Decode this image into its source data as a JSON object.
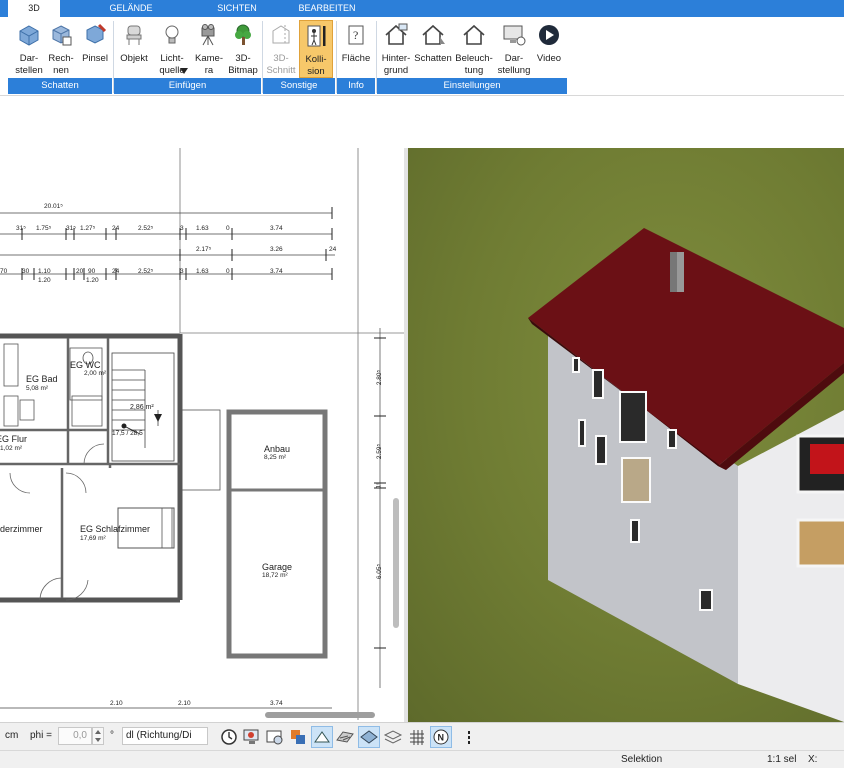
{
  "tabs": [
    {
      "label": "3D",
      "active": true
    },
    {
      "label": "GELÄNDE"
    },
    {
      "label": "SICHTEN"
    },
    {
      "label": "BEARBEITEN"
    }
  ],
  "ribbon": {
    "buttons": {
      "darstellen": "Dar-\nstellen",
      "rechnen": "Rech-\nnen",
      "pinsel": "Pinsel",
      "objekt": "Objekt",
      "lichtquelle": "Licht-\nquelle",
      "kamera": "Kame-\nra",
      "bitmap3d": "3D-\nBitmap",
      "schnitt3d": "3D-\nSchnitt",
      "kollision": "Kolli-\nsion",
      "flaeche": "Fläche",
      "hintergrund": "Hinter-\ngrund",
      "schatten": "Schatten",
      "beleuchtung": "Beleuch-\ntung",
      "darstellung": "Dar-\nstellung",
      "video": "Video"
    },
    "groups": {
      "schatten": "Schatten",
      "einfuegen": "Einfügen",
      "sonstige": "Sonstige",
      "info": "Info",
      "einstellungen": "Einstellungen"
    }
  },
  "plan": {
    "dims_row1": [
      "20.01⁵"
    ],
    "dims_row2": [
      "31⁵",
      "1.75⁵",
      "31⁵",
      "1.27⁵",
      "24",
      "2.52⁵",
      "3",
      "1.63",
      "0",
      "3.74"
    ],
    "dims_row3": [
      "2.17⁵",
      "3.26",
      "24"
    ],
    "dims_row4": [
      "70",
      "30",
      "1.10",
      "1.20",
      "20",
      "90",
      "1.20",
      "24",
      "2.52⁵",
      "3",
      "1.63",
      "0",
      "3.74"
    ],
    "dims_right": [
      "2.80⁵",
      "2.59⁵",
      "1⁵",
      "6.05⁵"
    ],
    "dims_bottom": [
      "2.10",
      "2.10",
      "3.74"
    ],
    "stair_label": "17,5 / 28,5",
    "stair_height": "2,86 m²",
    "rooms": [
      {
        "name": "EG Bad",
        "area": "5,08 m²"
      },
      {
        "name": "EG WC",
        "area": "2,00 m²"
      },
      {
        "name": "EG Flur",
        "area": "1,02 m²"
      },
      {
        "name": "derzimmer",
        "area": ""
      },
      {
        "name": "EG Schlafzimmer",
        "area": "17,69 m²"
      },
      {
        "name": "Anbau",
        "area": "8,25 m²"
      },
      {
        "name": "Garage",
        "area": "18,72 m²"
      }
    ]
  },
  "bottombar": {
    "unit": "cm",
    "phi_label": "phi =",
    "phi_value": "0,0",
    "degree": "°",
    "direction_select": "dl (Richtung/Di",
    "icons": [
      "clock-icon",
      "render-icon",
      "view-icon",
      "material-icon",
      "pen-icon",
      "hatch-icon",
      "layer-icon",
      "stack-icon",
      "grid-icon",
      "north-icon",
      "more-icon"
    ]
  },
  "status": {
    "mode": "Selektion",
    "scale": "1:1 sel",
    "x_label": "X:"
  },
  "colors": {
    "ribbon_blue": "#2c7fd9",
    "active_button": "#f7c86a",
    "grass": "#6f7c33",
    "roof": "#6b1015",
    "wall": "#e8e8ea"
  }
}
